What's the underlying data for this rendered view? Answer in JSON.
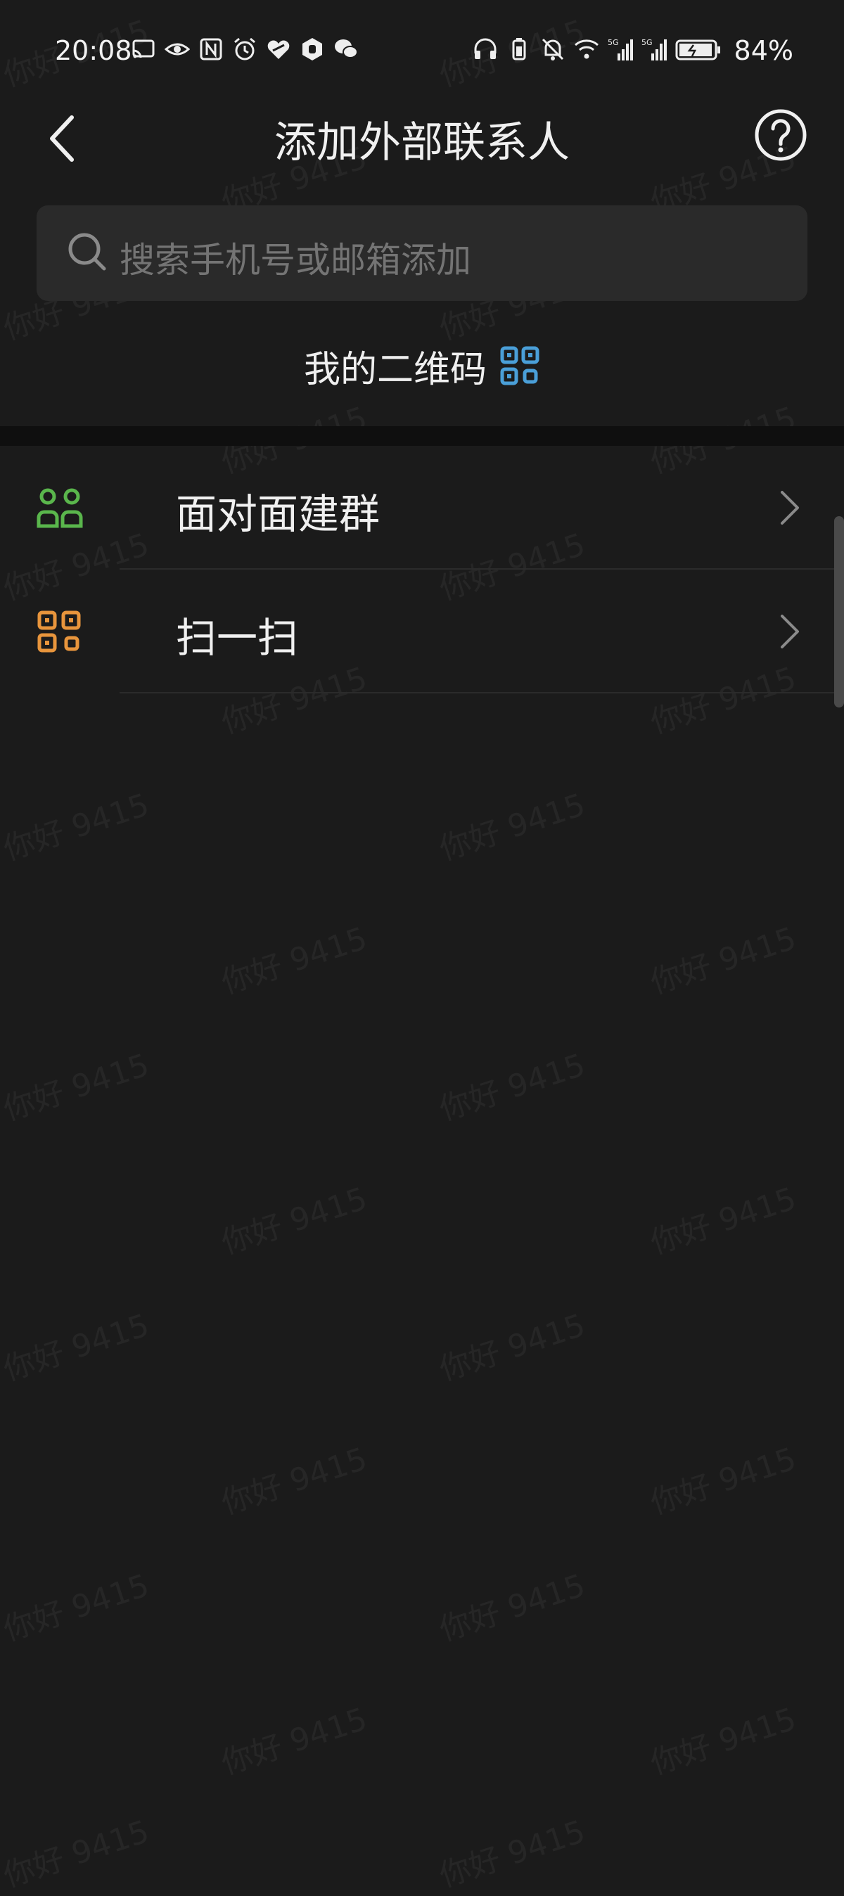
{
  "status_bar": {
    "time": "20:08",
    "battery": "84%",
    "left_icons": [
      "cast-icon",
      "eye-icon",
      "nfc-icon",
      "alarm-icon",
      "heart-icon",
      "hand-icon",
      "wechat-icon"
    ],
    "right_icons": [
      "headphones-icon",
      "battery-small-icon",
      "bell-muted-icon",
      "wifi-icon",
      "signal-5g-icon",
      "signal-5g-icon-2",
      "battery-icon"
    ]
  },
  "header": {
    "title": "添加外部联系人"
  },
  "search": {
    "placeholder": "搜索手机号或邮箱添加"
  },
  "my_qr": {
    "label": "我的二维码",
    "icon_color": "#4a9fd8"
  },
  "menu": [
    {
      "label": "面对面建群",
      "icon": "group-icon",
      "icon_color": "#5ab64c"
    },
    {
      "label": "扫一扫",
      "icon": "scan-icon",
      "icon_color": "#e8953c"
    }
  ],
  "watermark": "你好 9415"
}
